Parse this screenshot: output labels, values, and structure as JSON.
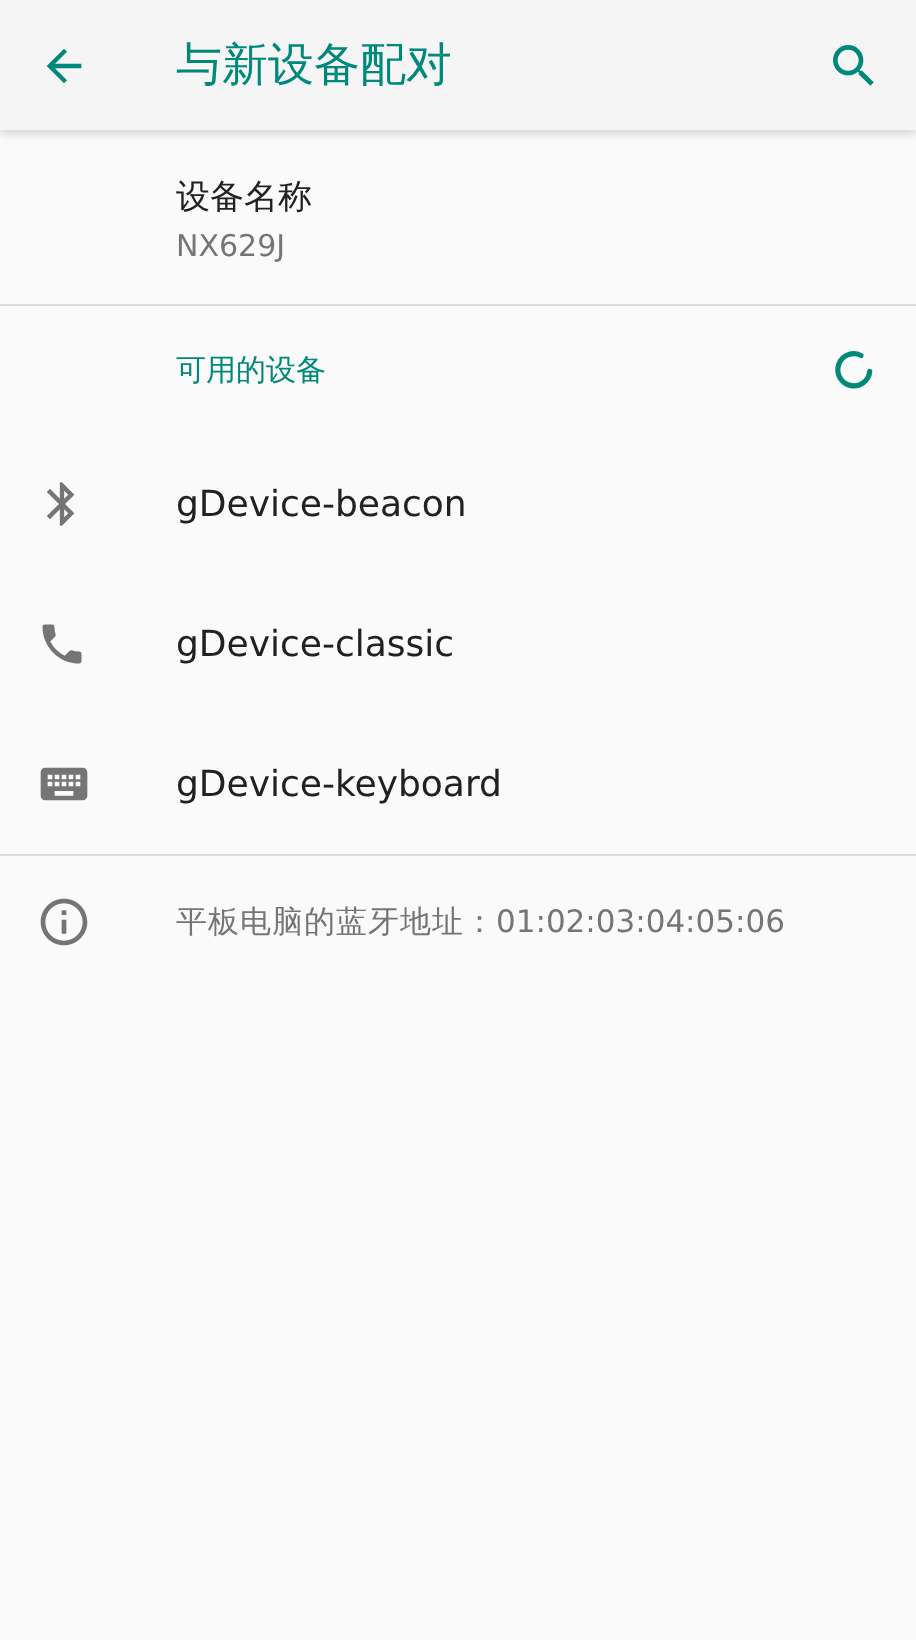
{
  "app_bar": {
    "title": "与新设备配对"
  },
  "device_name": {
    "label": "设备名称",
    "value": "NX629J"
  },
  "available": {
    "header": "可用的设备",
    "scanning": true,
    "devices": [
      {
        "name": "gDevice-beacon",
        "kind": "bluetooth"
      },
      {
        "name": "gDevice-classic",
        "kind": "phone"
      },
      {
        "name": "gDevice-keyboard",
        "kind": "keyboard"
      }
    ]
  },
  "footer": {
    "text": "平板电脑的蓝牙地址：01:02:03:04:05:06"
  }
}
